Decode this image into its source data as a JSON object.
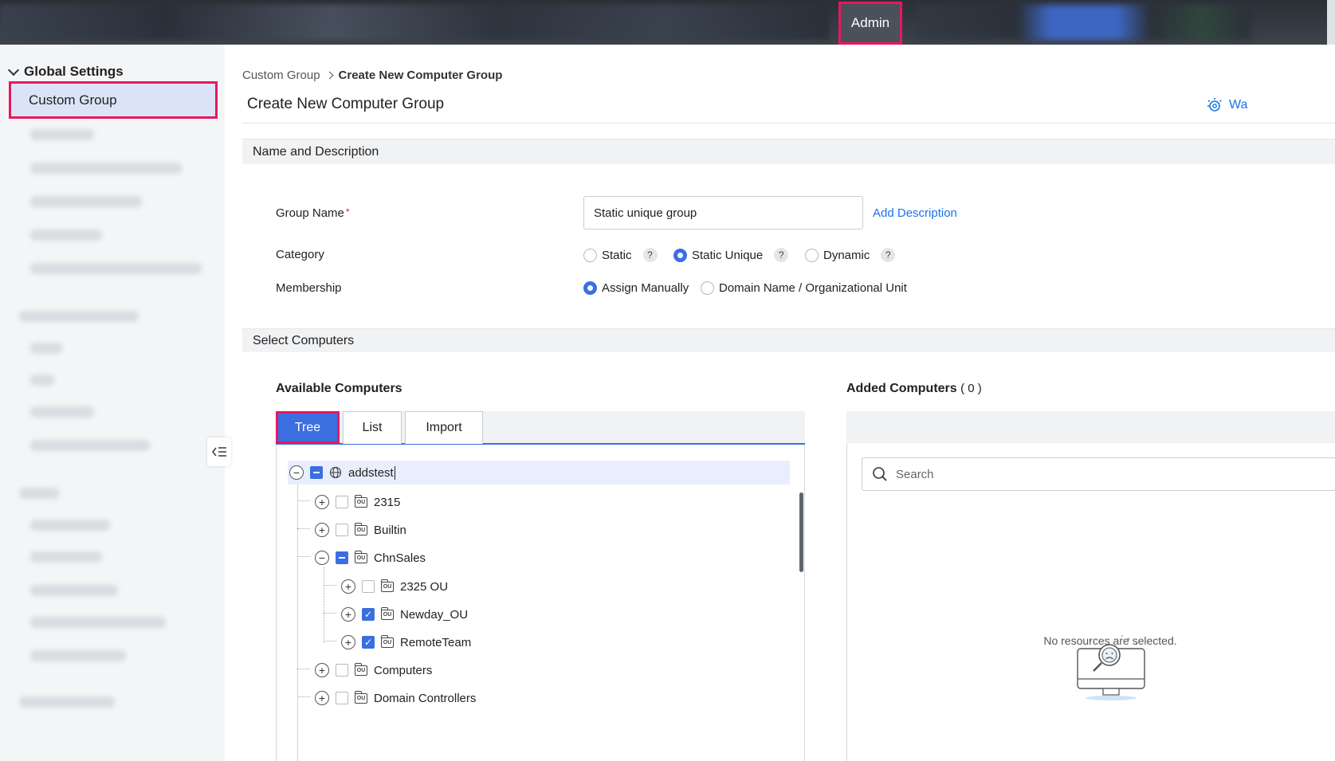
{
  "topbar": {
    "admin_tab": "Admin"
  },
  "sidebar": {
    "section_title": "Global Settings",
    "active_item": "Custom Group"
  },
  "breadcrumb": {
    "parent": "Custom Group",
    "current": "Create New Computer Group"
  },
  "page": {
    "title": "Create New Computer Group",
    "wizard_link": "Wa"
  },
  "name_desc": {
    "section_title": "Name and Description",
    "group_name_label": "Group Name",
    "required_mark": "*",
    "group_name_value": "Static unique group",
    "add_description": "Add Description",
    "category_label": "Category",
    "category_options": [
      "Static",
      "Static Unique",
      "Dynamic"
    ],
    "category_selected": "Static Unique",
    "help_mark": "?",
    "membership_label": "Membership",
    "membership_options": [
      "Assign Manually",
      "Domain Name / Organizational Unit"
    ],
    "membership_selected": "Assign Manually"
  },
  "select_computers": {
    "section_title": "Select Computers",
    "available_title": "Available Computers",
    "tabs": [
      "Tree",
      "List",
      "Import"
    ],
    "active_tab": "Tree",
    "tree": [
      {
        "label": "addstest",
        "level": 0,
        "expanded": true,
        "check": "partial",
        "icon": "globe-icon",
        "selected": true
      },
      {
        "label": "2315",
        "level": 1,
        "expanded": false,
        "check": "none",
        "icon": "ou-folder-icon"
      },
      {
        "label": "Builtin",
        "level": 1,
        "expanded": false,
        "check": "none",
        "icon": "ou-folder-icon"
      },
      {
        "label": "ChnSales",
        "level": 1,
        "expanded": true,
        "check": "partial",
        "icon": "ou-folder-icon"
      },
      {
        "label": "2325 OU",
        "level": 2,
        "expanded": false,
        "check": "none",
        "icon": "ou-folder-icon"
      },
      {
        "label": "Newday_OU",
        "level": 2,
        "expanded": false,
        "check": "checked",
        "icon": "ou-folder-icon"
      },
      {
        "label": "RemoteTeam",
        "level": 2,
        "expanded": false,
        "check": "checked",
        "icon": "ou-folder-icon"
      },
      {
        "label": "Computers",
        "level": 1,
        "expanded": false,
        "check": "none",
        "icon": "ou-folder-icon"
      },
      {
        "label": "Domain Controllers",
        "level": 1,
        "expanded": false,
        "check": "none",
        "icon": "ou-folder-icon"
      }
    ],
    "added_title": "Added Computers",
    "added_count": "( 0 )",
    "search_placeholder": "Search",
    "empty_message": "No resources are selected."
  }
}
